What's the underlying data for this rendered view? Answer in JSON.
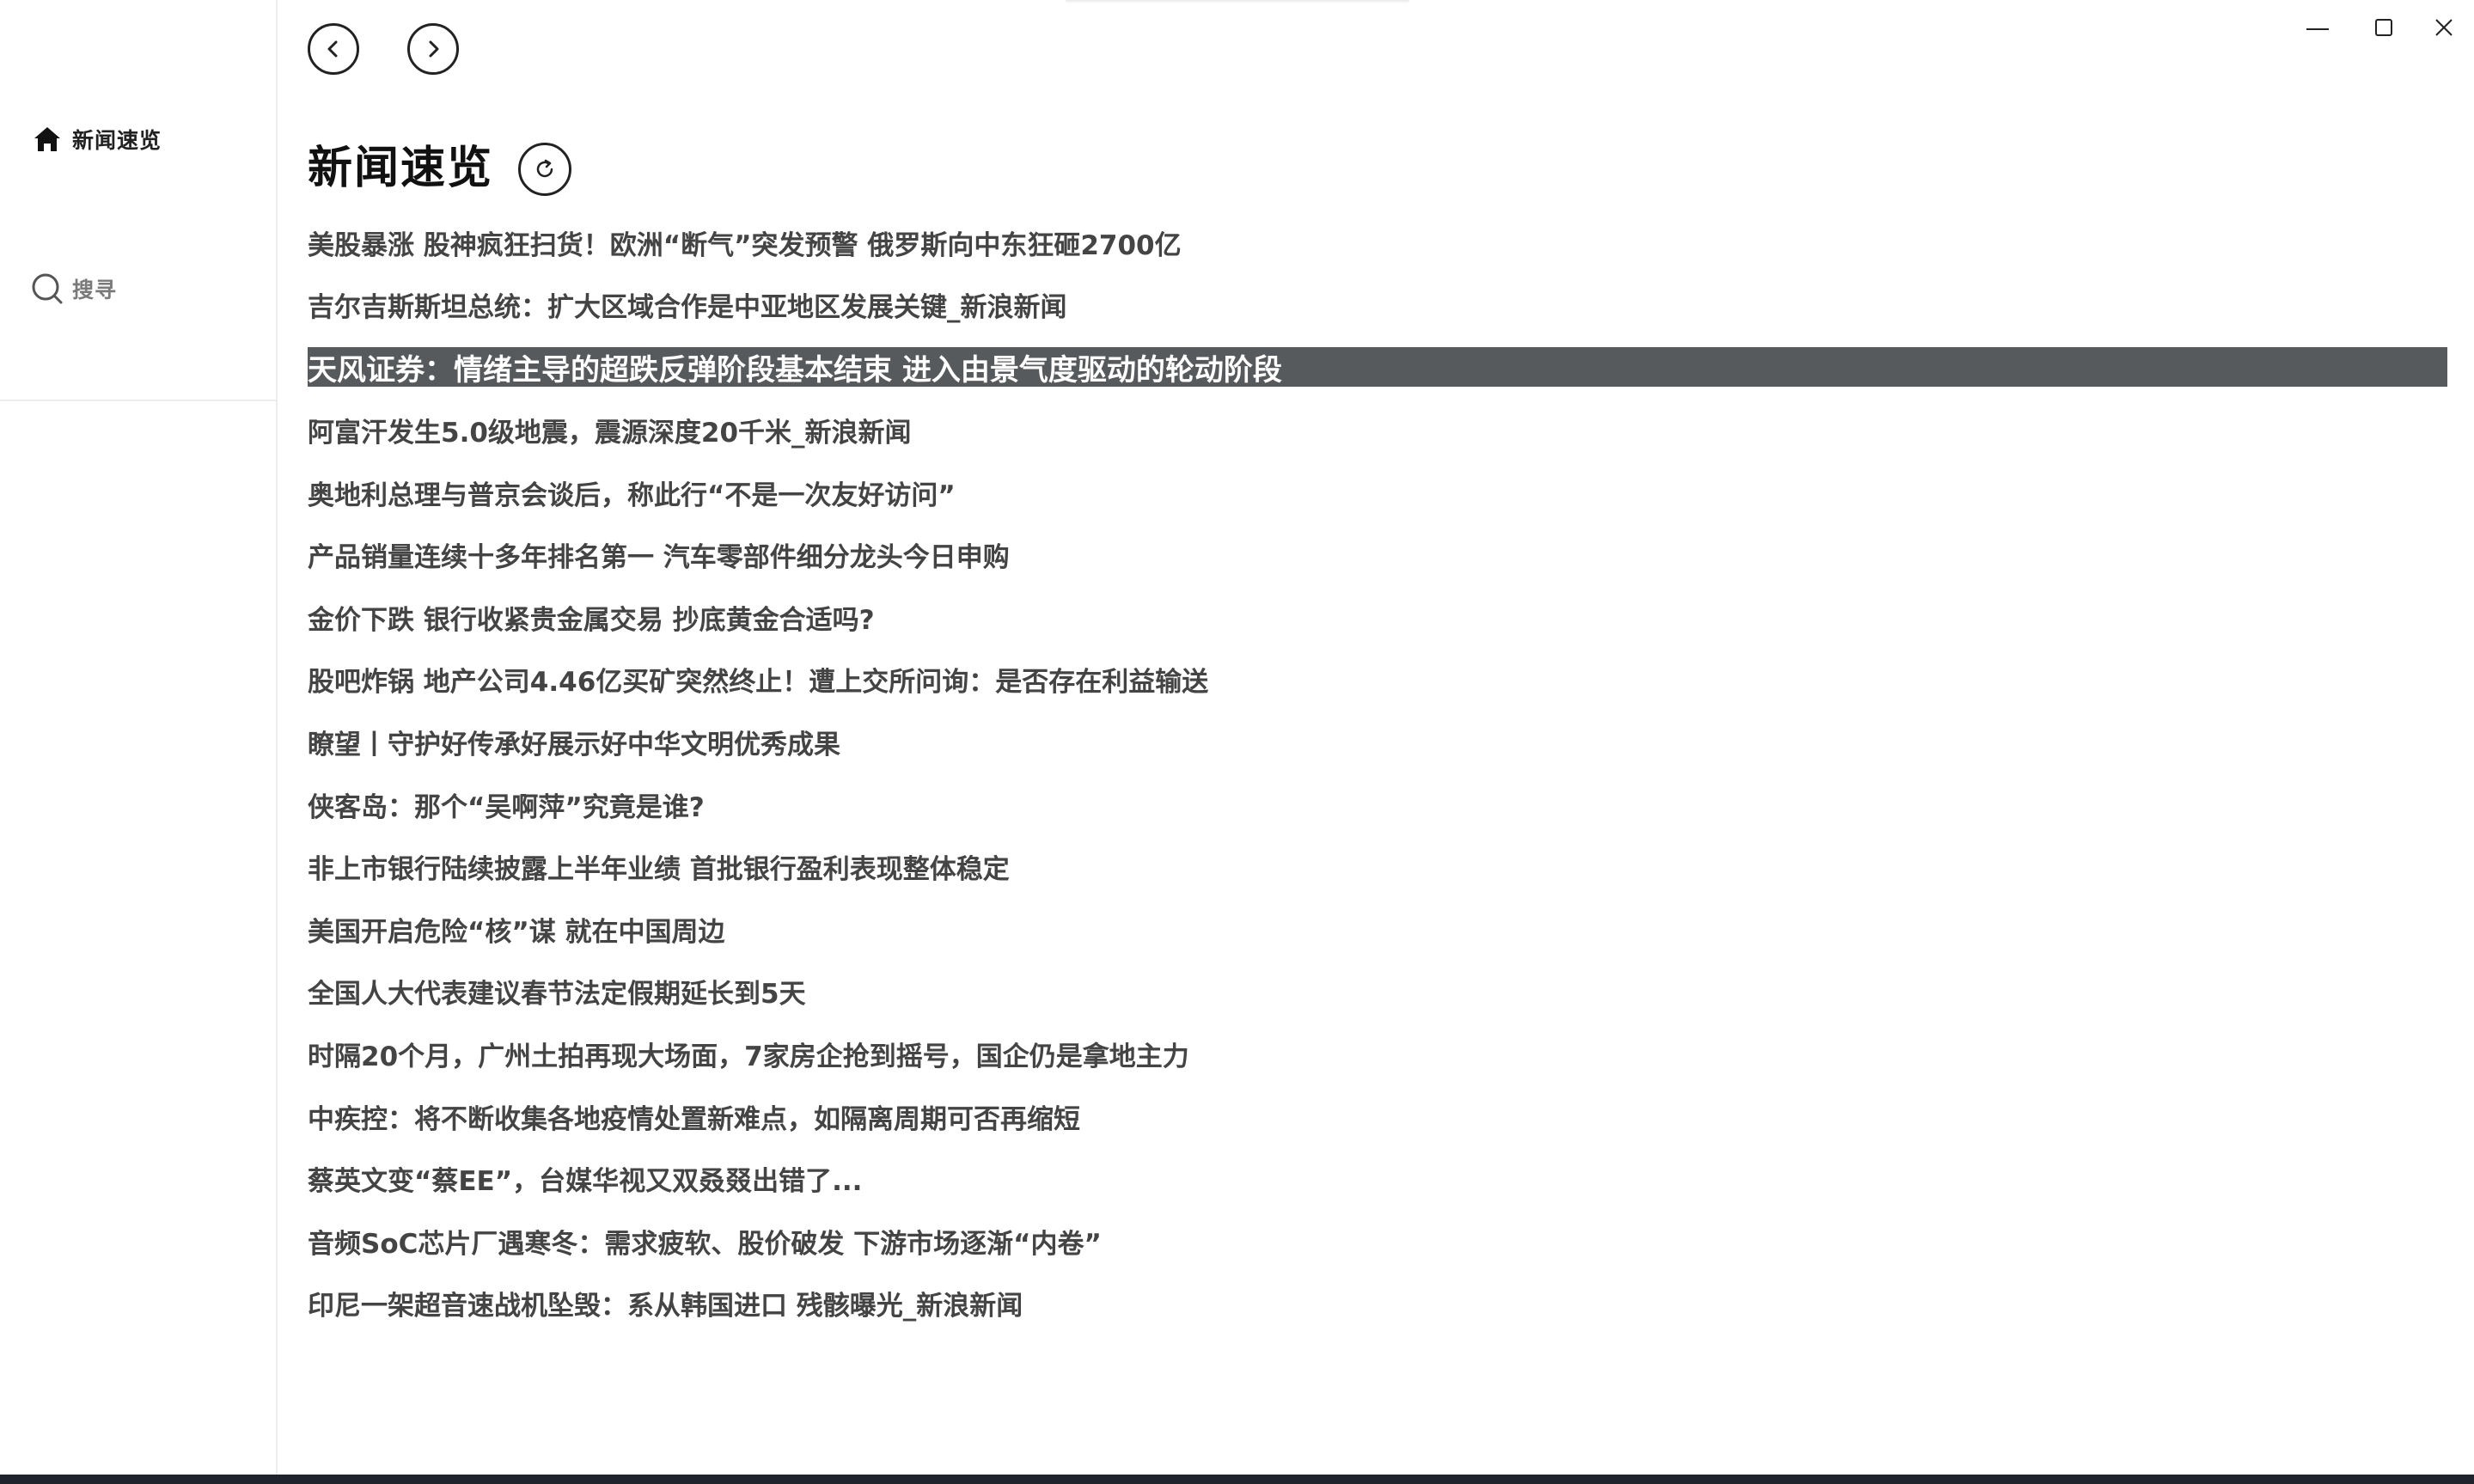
{
  "sidebar": {
    "items": [
      {
        "label": "新闻速览",
        "icon": "home-icon",
        "active": true
      },
      {
        "label": "搜寻",
        "icon": "search-icon",
        "active": false
      }
    ]
  },
  "page": {
    "title": "新闻速览"
  },
  "news": {
    "selected_index": 2,
    "items": [
      "美股暴涨 股神疯狂扫货！欧洲“断气”突发预警 俄罗斯向中东狂砸2700亿",
      "吉尔吉斯斯坦总统：扩大区域合作是中亚地区发展关键_新浪新闻",
      "天风证券：情绪主导的超跌反弹阶段基本结束 进入由景气度驱动的轮动阶段",
      "阿富汗发生5.0级地震，震源深度20千米_新浪新闻",
      "奥地利总理与普京会谈后，称此行“不是一次友好访问”",
      "产品销量连续十多年排名第一 汽车零部件细分龙头今日申购",
      "金价下跌 银行收紧贵金属交易 抄底黄金合适吗?",
      "股吧炸锅 地产公司4.46亿买矿突然终止！遭上交所问询：是否存在利益输送",
      "瞭望丨守护好传承好展示好中华文明优秀成果",
      "侠客岛：那个“吴啊萍”究竟是谁?",
      "非上市银行陆续披露上半年业绩 首批银行盈利表现整体稳定",
      "美国开启危险“核”谋 就在中国周边",
      "全国人大代表建议春节法定假期延长到5天",
      "时隔20个月，广州土拍再现大场面，7家房企抢到摇号，国企仍是拿地主力",
      "中疾控：将不断收集各地疫情处置新难点，如隔离周期可否再缩短",
      "蔡英文变“蔡EE”，台媒华视又双叒叕出错了...",
      "音频SoC芯片厂遇寒冬：需求疲软、股价破发 下游市场逐渐“内卷”",
      "印尼一架超音速战机坠毁：系从韩国进口 残骸曝光_新浪新闻"
    ]
  },
  "colors": {
    "selected_bg": "#575a5c",
    "text": "#444444",
    "title": "#111111"
  }
}
